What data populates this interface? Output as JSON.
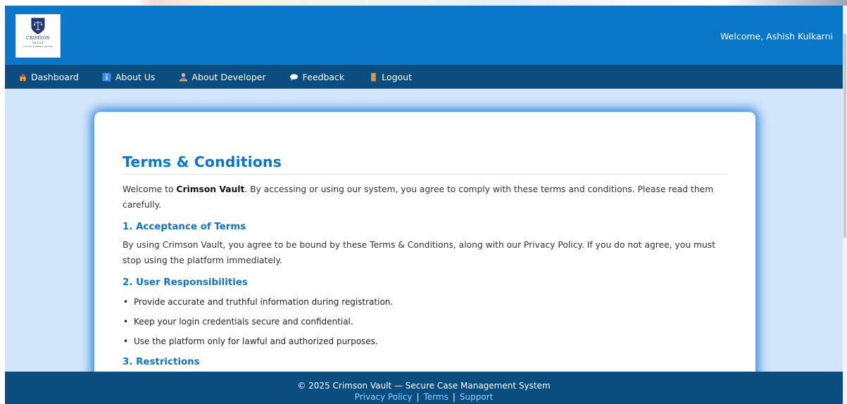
{
  "header": {
    "logo": {
      "title": "CRIMSON",
      "subtitle": "VAULT",
      "tagline": "JUDICIAL FORENSIC ARCHIVE"
    },
    "welcome": "Welcome, Ashish Kulkarni"
  },
  "nav": {
    "items": [
      {
        "label": "Dashboard",
        "icon": "home-icon"
      },
      {
        "label": "About Us",
        "icon": "info-icon"
      },
      {
        "label": "About Developer",
        "icon": "developer-icon"
      },
      {
        "label": "Feedback",
        "icon": "speech-bubble-icon"
      },
      {
        "label": "Logout",
        "icon": "door-icon"
      }
    ]
  },
  "terms": {
    "title": "Terms & Conditions",
    "intro_prefix": "Welcome to ",
    "intro_brand": "Crimson Vault",
    "intro_suffix": ". By accessing or using our system, you agree to comply with these terms and conditions. Please read them carefully.",
    "sections": [
      {
        "heading": "1. Acceptance of Terms",
        "text": "By using Crimson Vault, you agree to be bound by these Terms & Conditions, along with our Privacy Policy. If you do not agree, you must stop using the platform immediately."
      },
      {
        "heading": "2. User Responsibilities",
        "items": [
          "Provide accurate and truthful information during registration.",
          "Keep your login credentials secure and confidential.",
          "Use the platform only for lawful and authorized purposes."
        ]
      },
      {
        "heading": "3. Restrictions"
      }
    ]
  },
  "footer": {
    "copyright": "© 2025 Crimson Vault — Secure Case Management System",
    "links": [
      "Privacy Policy",
      "Terms",
      "Support"
    ],
    "separator": "|"
  },
  "colors": {
    "header_bg": "#0a77c9",
    "nav_bg": "#0c4d80",
    "page_bg": "#d2e6fb",
    "heading": "#0a77c9",
    "footer_link": "#8fd0ff"
  }
}
